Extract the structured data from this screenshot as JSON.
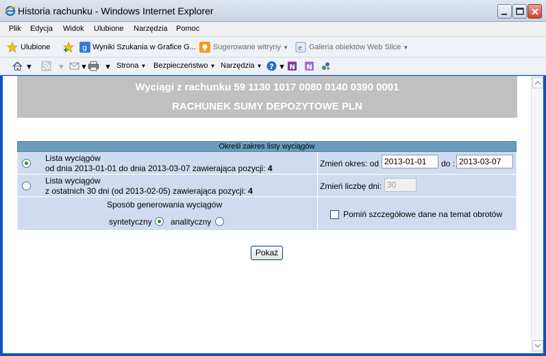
{
  "window": {
    "title": "Historia rachunku - Windows Internet Explorer"
  },
  "menu": [
    "Plik",
    "Edycja",
    "Widok",
    "Ulubione",
    "Narzędzia",
    "Pomoc"
  ],
  "favorites": {
    "label": "Ulubione",
    "items": [
      "Wyniki Szukania w Grafice G...",
      "Sugerowane witryny",
      "Galeria obiektów Web Slice"
    ]
  },
  "command": {
    "page": "Strona",
    "safety": "Bezpieczeństwo",
    "tools": "Narzędzia"
  },
  "header": {
    "line1": "Wyciągi z rachunku 59 1130 1017 0080 0140 0390 0001",
    "line2": "RACHUNEK SUMY DEPOZYTOWE PLN"
  },
  "panel": {
    "title": "Określ zakres listy wyciągów",
    "option1": {
      "line1": "Lista wyciągów",
      "line2_prefix": "od dnia 2013-01-01 do dnia 2013-03-07 zawierająca pozycji: ",
      "count": "4",
      "selected": true
    },
    "option2": {
      "line1": "Lista wyciągów",
      "line2_prefix": "z ostatnich 30 dni (od 2013-02-05) zawierająca pozycji: ",
      "count": "4",
      "selected": false
    },
    "period": {
      "label_from": "Zmień okres: od",
      "from": "2013-01-01",
      "label_to": "do :",
      "to": "2013-03-07"
    },
    "days": {
      "label": "Zmień liczbę dni:",
      "value": "30"
    },
    "generation": {
      "label": "Sposób generowania wyciągów",
      "synthetic": "syntetyczny",
      "analytic": "analityczny",
      "selected": "syntetyczny"
    },
    "skip_details": {
      "label": "Pomiń szczegółowe dane na temat obrotów",
      "checked": false
    }
  },
  "show_button": "Pokaż",
  "colors": {
    "header_bg": "#c0c0c0",
    "panel_head": "#6b9cbc",
    "row_bg": "#cfdcef"
  }
}
